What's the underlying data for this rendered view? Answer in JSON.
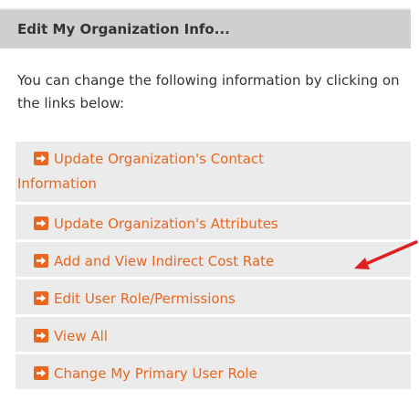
{
  "panel": {
    "title": "Edit My Organization Info..."
  },
  "intro": {
    "text": "You can change the following information by clicking on the links below:"
  },
  "links": [
    {
      "label_line1": "Update Organization's Contact",
      "label_line2": "Information",
      "icon": "arrow-right-icon"
    },
    {
      "label": "Update Organization's Attributes",
      "icon": "arrow-right-icon"
    },
    {
      "label": "Add and View Indirect Cost Rate",
      "icon": "arrow-right-icon"
    },
    {
      "label": "Edit User Role/Permissions",
      "icon": "arrow-right-icon"
    },
    {
      "label": "View All",
      "icon": "arrow-right-icon"
    },
    {
      "label": "Change My Primary User Role",
      "icon": "arrow-right-icon"
    }
  ],
  "colors": {
    "link": "#e8661f",
    "header_bg": "#cfcfcf",
    "item_bg": "#ebebeb",
    "callout_arrow": "#e02020"
  }
}
